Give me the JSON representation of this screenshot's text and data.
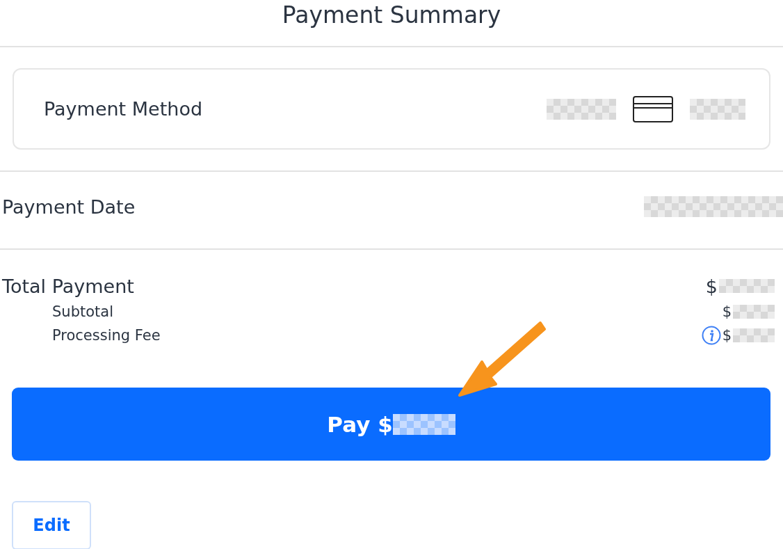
{
  "title": "Payment Summary",
  "payment_method": {
    "label": "Payment Method"
  },
  "rows": [
    {
      "kind": "date",
      "label": "Payment Date",
      "value_prefix": ""
    },
    {
      "kind": "total",
      "label": "Total Payment",
      "value_prefix": "$"
    },
    {
      "kind": "sub",
      "label": "Subtotal",
      "value_prefix": "$",
      "info": false
    },
    {
      "kind": "sub",
      "label": "Processing Fee",
      "value_prefix": "$",
      "info": true
    }
  ],
  "pay_button": {
    "label": "Pay $"
  },
  "edit_button": {
    "label": "Edit"
  }
}
